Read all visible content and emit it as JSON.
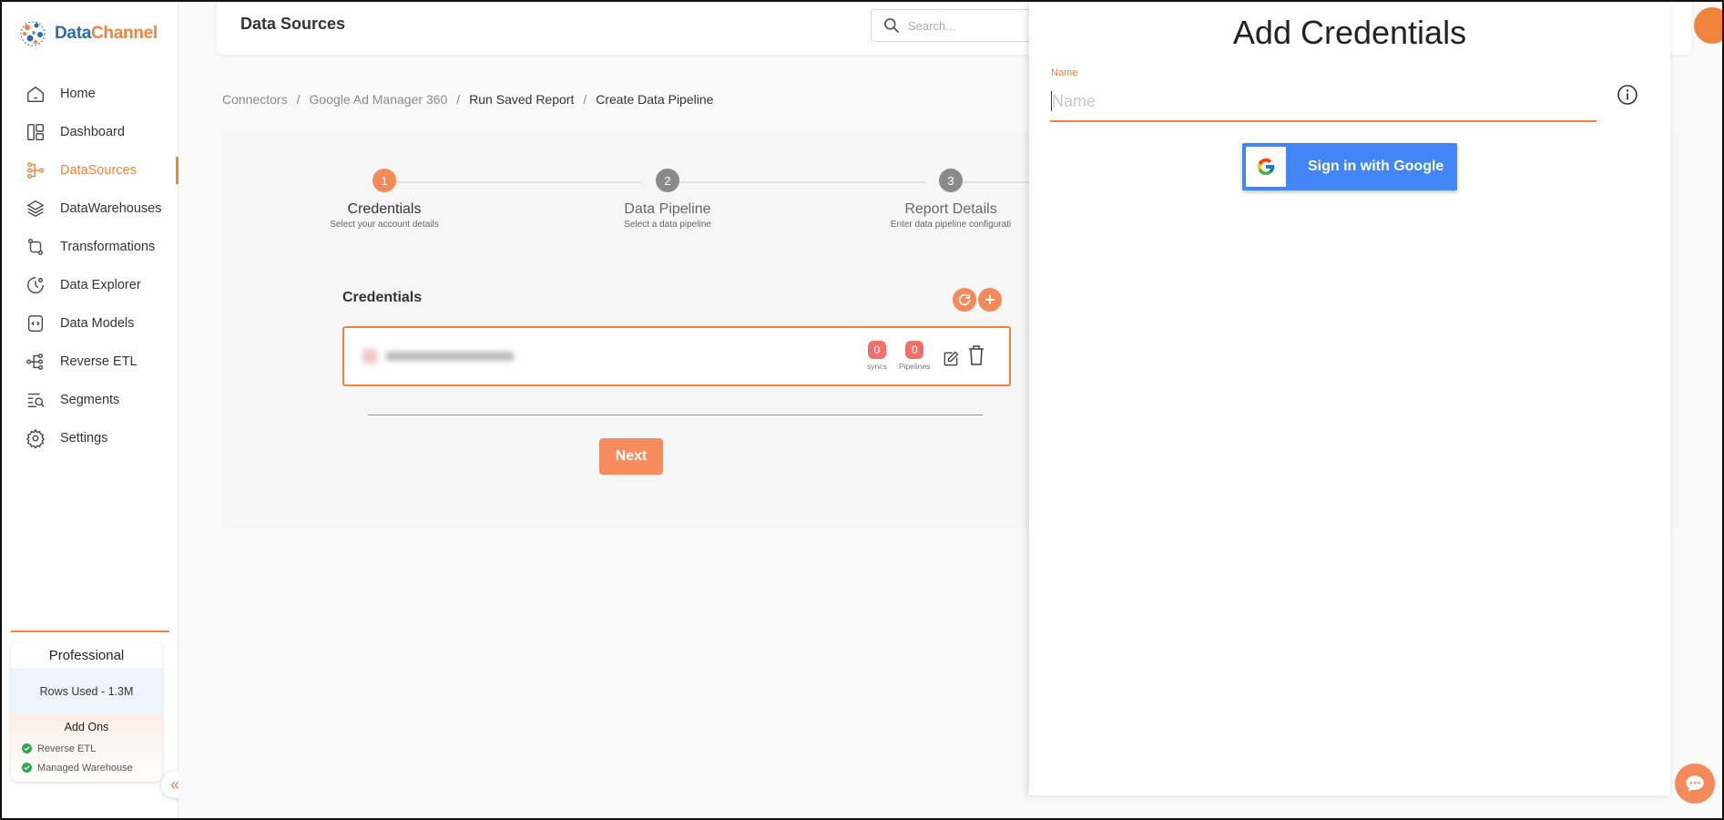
{
  "app": {
    "logo_part1": "Data",
    "logo_part2": "Channel"
  },
  "sidebar": {
    "items": [
      {
        "label": "Home",
        "icon": "home-icon"
      },
      {
        "label": "Dashboard",
        "icon": "dashboard-icon"
      },
      {
        "label": "DataSources",
        "icon": "datasources-icon",
        "active": true
      },
      {
        "label": "DataWarehouses",
        "icon": "layers-icon"
      },
      {
        "label": "Transformations",
        "icon": "transform-icon"
      },
      {
        "label": "Data Explorer",
        "icon": "explorer-icon"
      },
      {
        "label": "Data Models",
        "icon": "models-icon"
      },
      {
        "label": "Reverse ETL",
        "icon": "reverse-etl-icon"
      },
      {
        "label": "Segments",
        "icon": "segments-icon"
      },
      {
        "label": "Settings",
        "icon": "gear-icon"
      }
    ],
    "plan": {
      "name": "Professional",
      "rows_used": "Rows Used - 1.3M",
      "addons_title": "Add Ons",
      "addons": [
        "Reverse ETL",
        "Managed Warehouse"
      ]
    }
  },
  "header": {
    "title": "Data Sources",
    "search_placeholder": "Search..."
  },
  "breadcrumb": {
    "items": [
      "Connectors",
      "Google Ad Manager 360",
      "Run Saved Report",
      "Create Data Pipeline"
    ],
    "separator": "/"
  },
  "stepper": {
    "steps": [
      {
        "number": "1",
        "title": "Credentials",
        "subtitle": "Select your account details",
        "state": "active"
      },
      {
        "number": "2",
        "title": "Data Pipeline",
        "subtitle": "Select a data pipeline",
        "state": "inactive"
      },
      {
        "number": "3",
        "title": "Report Details",
        "subtitle": "Enter data pipeline configurati",
        "state": "inactive"
      }
    ]
  },
  "credentials": {
    "heading": "Credentials",
    "syncs_count": "0",
    "syncs_label": "syncs",
    "pipelines_count": "0",
    "pipelines_label": "Pipelines"
  },
  "actions": {
    "next_label": "Next"
  },
  "drawer": {
    "title": "Add Credentials",
    "name_label": "Name",
    "name_placeholder": "Name",
    "name_value": "",
    "google_button": "Sign in with Google"
  },
  "colors": {
    "accent": "#f0843c",
    "google_blue": "#4285f4",
    "badge_red": "#f0706a",
    "check_green": "#2eaa4d"
  }
}
